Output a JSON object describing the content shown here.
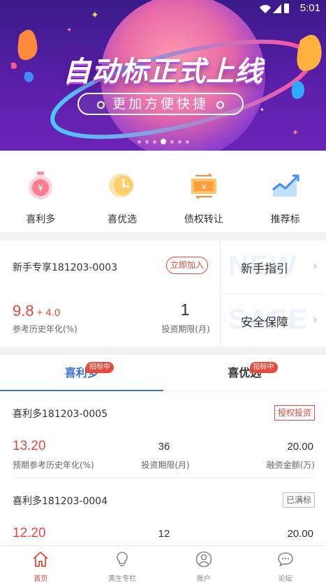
{
  "status_bar": {
    "time": "5:01"
  },
  "banner": {
    "title": "自动标正式上线",
    "subtitle": "更加方便快捷",
    "page_count": 7,
    "active_page": 4
  },
  "categories": [
    {
      "label": "喜利多",
      "icon": "stopwatch-yen-icon"
    },
    {
      "label": "喜优选",
      "icon": "clock-coin-icon"
    },
    {
      "label": "债权转让",
      "icon": "yen-transfer-icon"
    },
    {
      "label": "推荐标",
      "icon": "trend-chart-icon"
    }
  ],
  "newbie": {
    "name": "新手专享181203-0003",
    "join_label": "立即加入",
    "rate": "9.8",
    "rate_bonus": "+ 4.0",
    "rate_label": "参考历史年化(%)",
    "term": "1",
    "term_label": "投资期限(月)",
    "links": [
      {
        "label": "新手指引",
        "watermark": "NEW"
      },
      {
        "label": "安全保障",
        "watermark": "SAFE"
      }
    ]
  },
  "tabs": [
    {
      "label": "喜利多",
      "badge": "招标中",
      "active": true
    },
    {
      "label": "喜优选",
      "badge": "招标中",
      "active": false
    }
  ],
  "products": [
    {
      "name": "喜利多181203-0005",
      "tag": "授权投资",
      "tag_style": "red",
      "rate": "13.20",
      "term": "36",
      "amount": "20.00",
      "rate_label": "预期参考历史年化(%)",
      "term_label": "投资期限(月)",
      "amount_label": "融资金额(万)"
    },
    {
      "name": "喜利多181203-0004",
      "tag": "已满标",
      "tag_style": "gray",
      "rate": "12.20",
      "term": "12",
      "amount": "20.00",
      "rate_label": "",
      "term_label": "",
      "amount_label": ""
    }
  ],
  "bottom_nav": [
    {
      "label": "首页",
      "icon": "home-icon",
      "active": true
    },
    {
      "label": "黄生专栏",
      "icon": "lightbulb-icon",
      "active": false
    },
    {
      "label": "账户",
      "icon": "user-icon",
      "active": false
    },
    {
      "label": "论坛",
      "icon": "chat-icon",
      "active": false
    }
  ],
  "colors": {
    "accent_red": "#e04a3f",
    "accent_blue": "#3c6fd6",
    "banner_purple": "#4a1d9a"
  }
}
